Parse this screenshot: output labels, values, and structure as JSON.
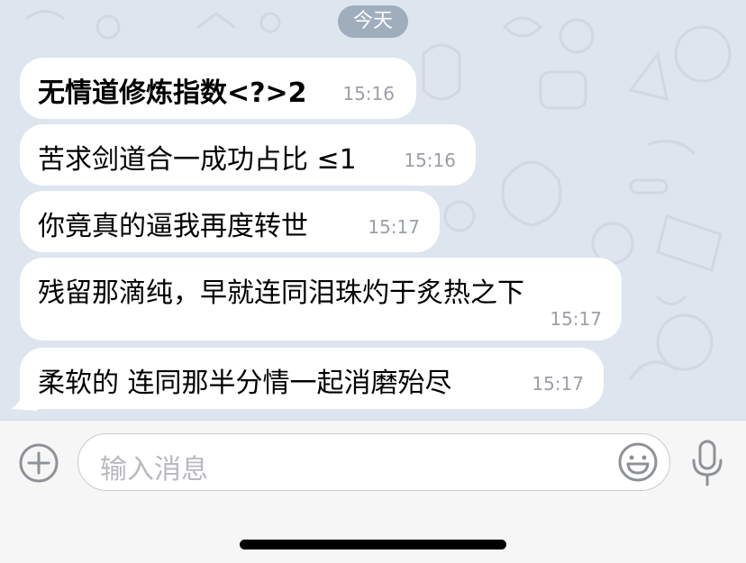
{
  "date_separator": "今天",
  "messages": [
    {
      "text": "无情道修炼指数<?>2",
      "time": "15:16"
    },
    {
      "text": "苦求剑道合一成功占比 ≤1",
      "time": "15:16"
    },
    {
      "text": "你竟真的逼我再度转世",
      "time": "15:17"
    },
    {
      "text": "残留那滴纯，早就连同泪珠灼于炙热之下",
      "time": "15:17"
    },
    {
      "text": "柔软的 连同那半分情一起消磨殆尽",
      "time": "15:17"
    }
  ],
  "composer": {
    "placeholder": "输入消息"
  },
  "icons": {
    "attach": "plus-circle-icon",
    "emoji": "smiley-face-icon",
    "mic": "microphone-icon"
  },
  "colors": {
    "chat_background": "#dde5ee",
    "bubble": "#ffffff",
    "date_pill": "#9fadbd",
    "timestamp": "#9b9fa6",
    "icon_gray": "#8e9196"
  }
}
